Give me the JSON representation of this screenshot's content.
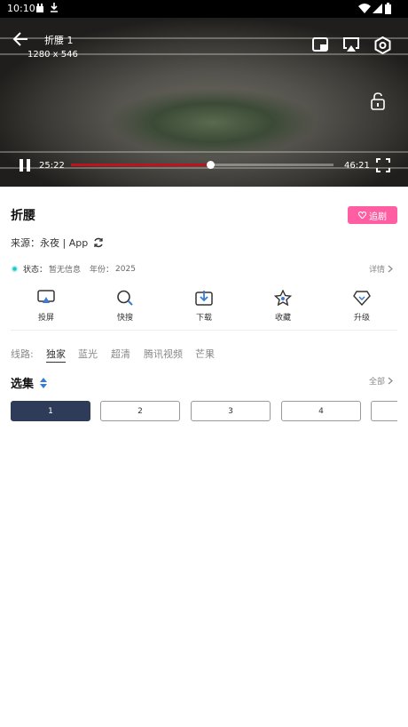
{
  "status_bar": {
    "time": "10:10"
  },
  "player": {
    "title": "折腰 1",
    "resolution": "1280 x 546",
    "current_time": "25:22",
    "total_time": "46:21",
    "progress_fraction": 0.53
  },
  "info": {
    "title": "折腰",
    "follow_label": "追剧",
    "source": "来源：永夜 | App",
    "status_label": "状态：",
    "status_value": "暂无信息",
    "year_label": "年份：",
    "year_value": "2025",
    "details_label": "详情"
  },
  "actions": [
    {
      "label": "投屏",
      "icon": "cast-icon"
    },
    {
      "label": "快搜",
      "icon": "search-icon"
    },
    {
      "label": "下载",
      "icon": "download-icon"
    },
    {
      "label": "收藏",
      "icon": "star-icon"
    },
    {
      "label": "升级",
      "icon": "diamond-icon"
    }
  ],
  "lines": {
    "label": "线路:",
    "options": [
      "独家",
      "蓝光",
      "超清",
      "腾讯视频",
      "芒果"
    ],
    "selected": "独家"
  },
  "episodes": {
    "title": "选集",
    "all_label": "全部",
    "items": [
      "1",
      "2",
      "3",
      "4"
    ],
    "selected": "1"
  },
  "colors": {
    "accent_pink": "#ff5fa2",
    "episode_active": "#2e3c5a",
    "progress": "#c0121a",
    "status_dot": "#1ec8c8"
  }
}
